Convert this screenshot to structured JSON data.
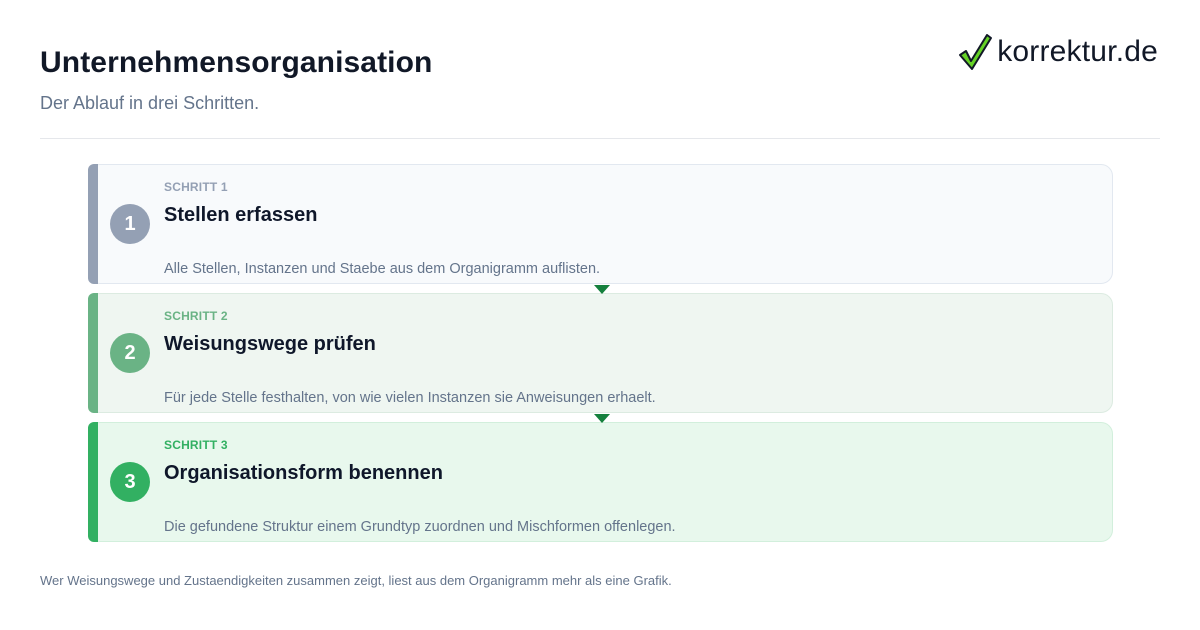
{
  "header": {
    "title": "Unternehmensorganisation",
    "subtitle": "Der Ablauf in drei Schritten."
  },
  "logo": {
    "text": "korrektur.de",
    "icon": "checkmark-icon",
    "check_color": "#65d126"
  },
  "steps": [
    {
      "number": "1",
      "label": "SCHRITT 1",
      "heading": "Stellen erfassen",
      "description": "Alle Stellen, Instanzen und Staebe aus dem Organigramm auflisten.",
      "accent": "#94a0b4",
      "background": "#f8fafc",
      "border": "#e2e8f0"
    },
    {
      "number": "2",
      "label": "SCHRITT 2",
      "heading": "Weisungswege prüfen",
      "description": "Für jede Stelle festhalten, von wie vielen Instanzen sie Anweisungen erhaelt.",
      "accent": "#6ab385",
      "background": "#eff6f1",
      "border": "#dcebe1"
    },
    {
      "number": "3",
      "label": "SCHRITT 3",
      "heading": "Organisationsform benennen",
      "description": "Die gefundene Struktur einem Grundtyp zuordnen und Mischformen offenlegen.",
      "accent": "#32b062",
      "background": "#e8f8ed",
      "border": "#d2efdc"
    }
  ],
  "connector_color": "#15803d",
  "footer": {
    "note": "Wer Weisungswege und Zustaendigkeiten zusammen zeigt, liest aus dem Organigramm mehr als eine Grafik."
  }
}
